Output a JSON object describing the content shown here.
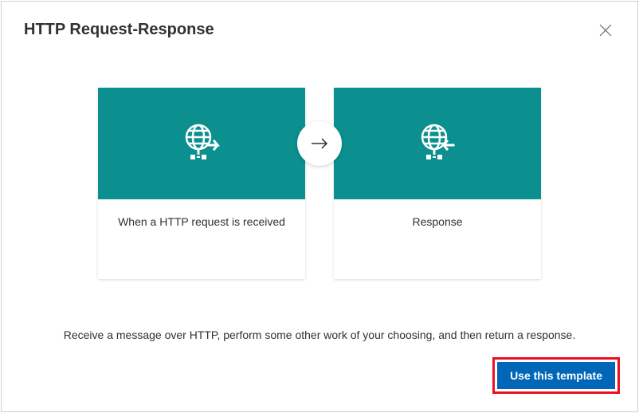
{
  "header": {
    "title": "HTTP Request-Response"
  },
  "flow": {
    "step1_label": "When a HTTP request is received",
    "step2_label": "Response"
  },
  "description": "Receive a message over HTTP, perform some other work of your choosing, and then return a response.",
  "footer": {
    "primary_button": "Use this template"
  }
}
